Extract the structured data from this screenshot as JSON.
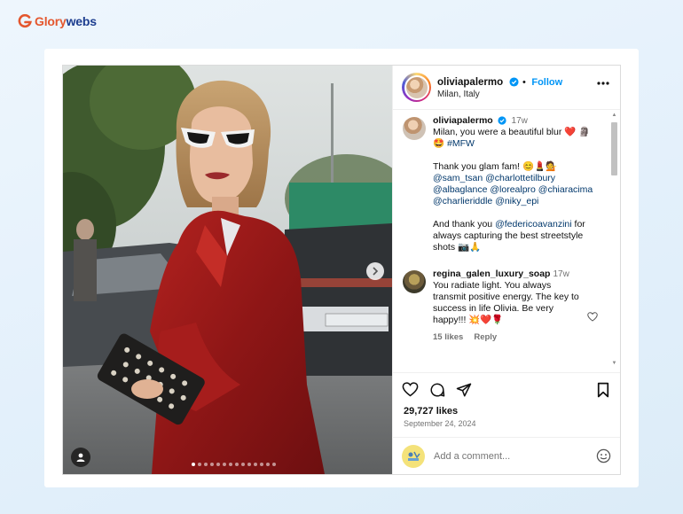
{
  "brand": {
    "name_part1": "Glory",
    "name_part2": "webs",
    "logo_icon": "gw-mark-icon"
  },
  "header": {
    "username": "oliviapalermo",
    "follow_separator": "•",
    "follow_label": "Follow",
    "location": "Milan, Italy"
  },
  "caption": {
    "username": "oliviapalermo",
    "time": "17w",
    "line1": "Milan, you were a beautiful blur ❤️ 🗿",
    "line2_emoji": "🤩",
    "line2_tag": "#MFW",
    "glam": "Thank you glam fam! 😊💄💁",
    "mentions1": "@sam_tsan @charlottetilbury",
    "mentions2": "@albaglance @lorealpro @chiaracima",
    "mentions3": "@charlieriddle @niky_epi",
    "thanks_prefix": "And thank you ",
    "thanks_mention": "@federicoavanzini",
    "thanks_suffix": " for",
    "line_cap2": "always capturing the best streetstyle",
    "line_cap3": "shots 📷🙏"
  },
  "comment": {
    "username": "regina_galen_luxury_soap",
    "time": "17w",
    "text": "You radiate light. You always transmit positive energy. The key to success in life Olivia. Be very happy!!! 💥❤️🌹",
    "likes": "15 likes",
    "reply_label": "Reply"
  },
  "post": {
    "likes_count": "29,727 likes",
    "date": "September 24, 2024",
    "add_comment_placeholder": "Add a comment...",
    "carousel_total": 14,
    "carousel_active": 1
  },
  "colors": {
    "accent": "#0095f6",
    "brand_orange": "#e4572e",
    "brand_navy": "#1c3d8f"
  }
}
